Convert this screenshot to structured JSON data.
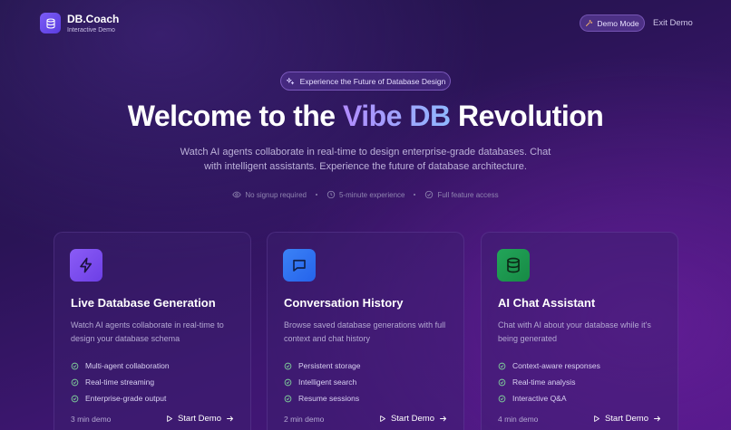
{
  "brand": {
    "title": "DB.Coach",
    "subtitle": "Interactive Demo"
  },
  "header": {
    "demo_mode_label": "Demo Mode",
    "exit_label": "Exit Demo"
  },
  "hero": {
    "pill_label": "Experience the Future of Database Design",
    "headline_pre": "Welcome to the ",
    "headline_accent": "Vibe DB",
    "headline_post": " Revolution",
    "subtext": "Watch AI agents collaborate in real-time to design enterprise-grade databases. Chat with intelligent assistants. Experience the future of database architecture.",
    "features": [
      "No signup required",
      "5-minute experience",
      "Full feature access"
    ]
  },
  "cards": [
    {
      "title": "Live Database Generation",
      "description": "Watch AI agents collaborate in real-time to design your database schema",
      "bullets": [
        "Multi-agent collaboration",
        "Real-time streaming",
        "Enterprise-grade output"
      ],
      "duration": "3 min demo",
      "cta": "Start Demo",
      "icon": "lightning-icon",
      "color_from": "#8b5cf6",
      "color_to": "#6d3fe6"
    },
    {
      "title": "Conversation History",
      "description": "Browse saved database generations with full context and chat history",
      "bullets": [
        "Persistent storage",
        "Intelligent search",
        "Resume sessions"
      ],
      "duration": "2 min demo",
      "cta": "Start Demo",
      "icon": "chat-bubble-icon",
      "color_from": "#3b82f6",
      "color_to": "#2563eb"
    },
    {
      "title": "AI Chat Assistant",
      "description": "Chat with AI about your database while it's being generated",
      "bullets": [
        "Context-aware responses",
        "Real-time analysis",
        "Interactive Q&A"
      ],
      "duration": "4 min demo",
      "cta": "Start Demo",
      "icon": "database-icon",
      "color_from": "#22a559",
      "color_to": "#178a45"
    }
  ],
  "colors": {
    "check": "#7fcf9a",
    "accent_start": "#b28cff",
    "accent_end": "#8fb8ff"
  }
}
